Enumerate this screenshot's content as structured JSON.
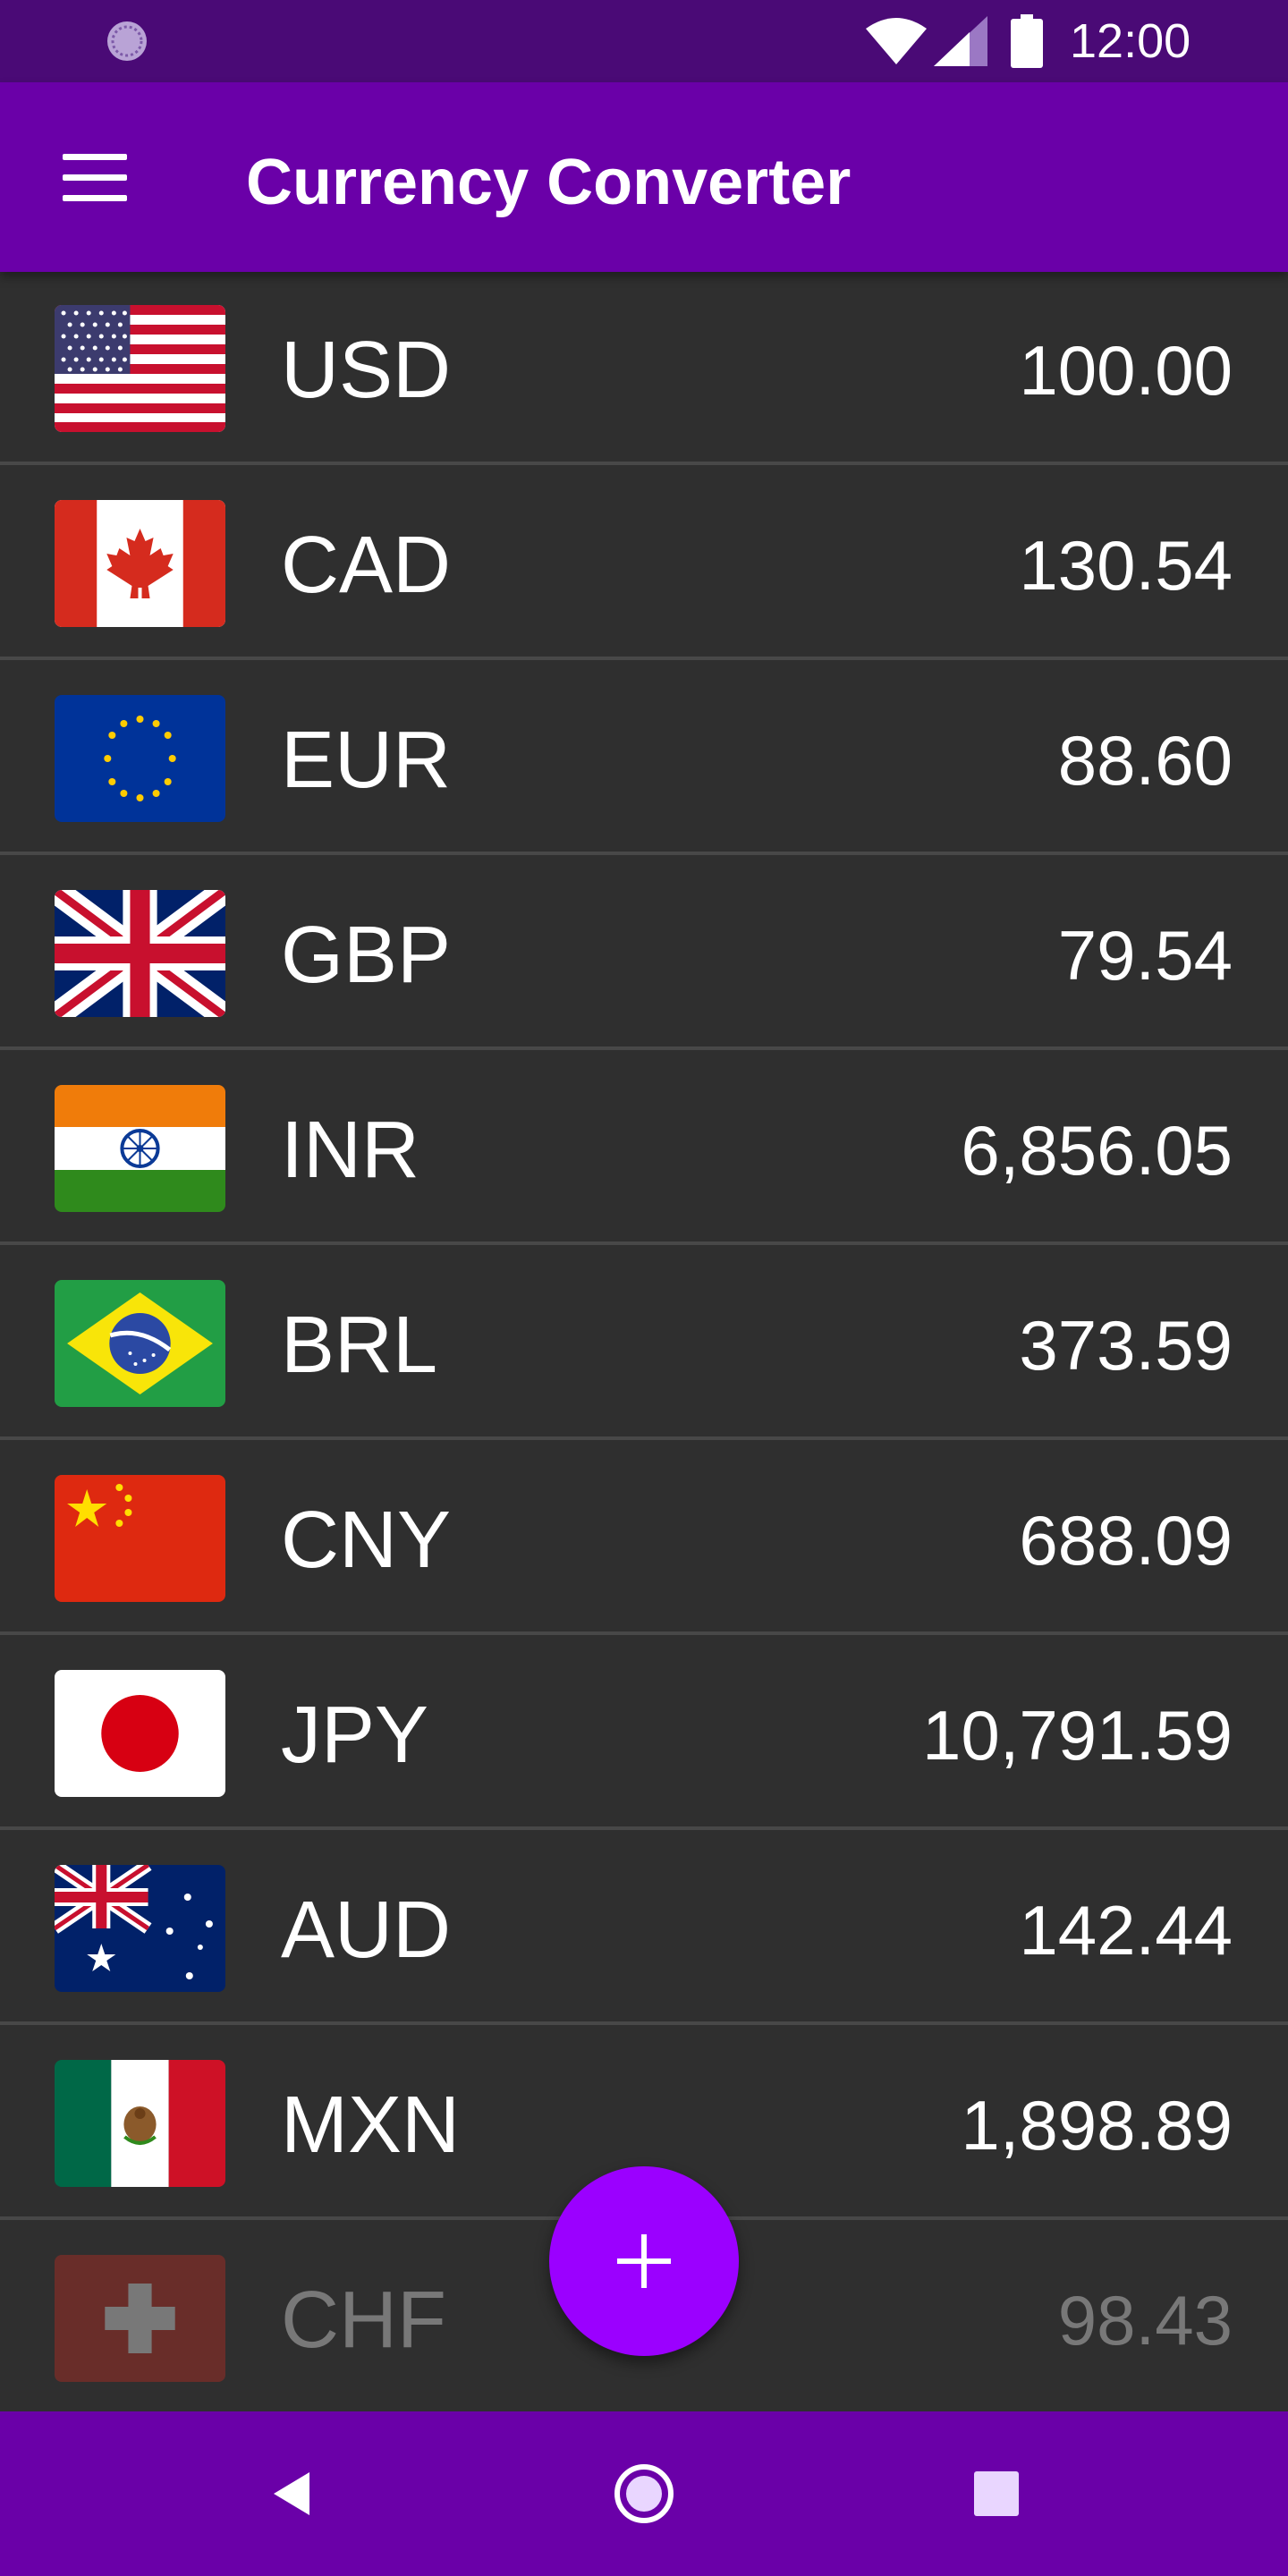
{
  "status_bar": {
    "time": "12:00",
    "icons": [
      "sync-icon",
      "wifi-icon",
      "signal-icon",
      "battery-icon"
    ]
  },
  "app_bar": {
    "title": "Currency Converter",
    "menu_icon": "hamburger-menu-icon"
  },
  "currencies": [
    {
      "code": "USD",
      "amount": "100.00",
      "flag": "us-flag-icon"
    },
    {
      "code": "CAD",
      "amount": "130.54",
      "flag": "canada-flag-icon"
    },
    {
      "code": "EUR",
      "amount": "88.60",
      "flag": "eu-flag-icon"
    },
    {
      "code": "GBP",
      "amount": "79.54",
      "flag": "uk-flag-icon"
    },
    {
      "code": "INR",
      "amount": "6,856.05",
      "flag": "india-flag-icon"
    },
    {
      "code": "BRL",
      "amount": "373.59",
      "flag": "brazil-flag-icon"
    },
    {
      "code": "CNY",
      "amount": "688.09",
      "flag": "china-flag-icon"
    },
    {
      "code": "JPY",
      "amount": "10,791.59",
      "flag": "japan-flag-icon"
    },
    {
      "code": "AUD",
      "amount": "142.44",
      "flag": "australia-flag-icon"
    },
    {
      "code": "MXN",
      "amount": "1,898.89",
      "flag": "mexico-flag-icon"
    },
    {
      "code": "CHF",
      "amount": "98.43",
      "flag": "switzerland-flag-icon"
    }
  ],
  "fab": {
    "icon": "plus-icon"
  },
  "nav_bar": {
    "icons": [
      "back-icon",
      "home-icon",
      "recents-icon"
    ]
  },
  "colors": {
    "status_bar": "#4a0a76",
    "app_bar": "#6a00a8",
    "fab": "#9b00ff",
    "list_background": "#2f2f2f",
    "divider": "#484848"
  }
}
